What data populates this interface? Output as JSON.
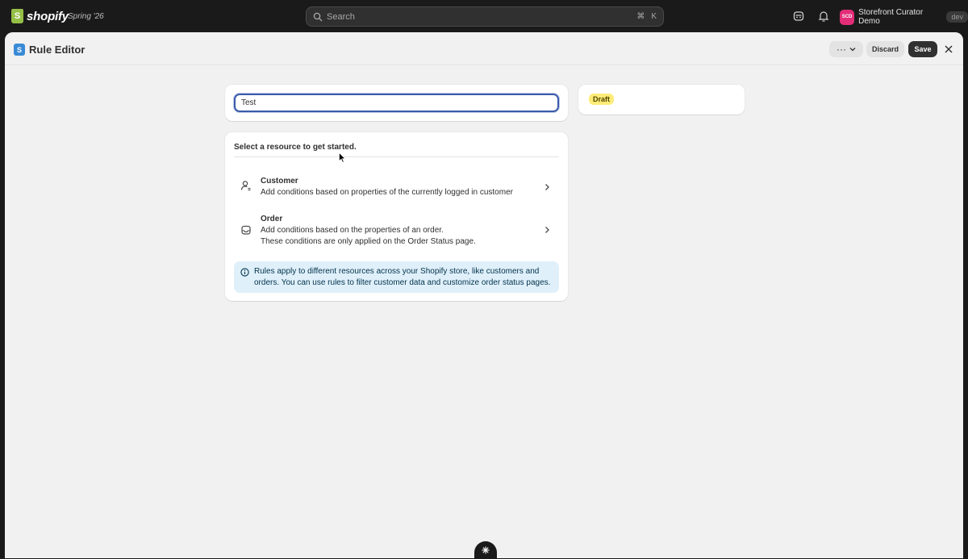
{
  "topbar": {
    "brand": "shopify",
    "release": "Spring '26",
    "search_placeholder": "Search",
    "shortcut_cmd": "⌘",
    "shortcut_key": "K",
    "store_initials": "SCD",
    "store_name": "Storefront Curator Demo",
    "store_badge": "dev"
  },
  "header": {
    "app_icon_letter": "S",
    "title": "Rule Editor",
    "more_label": "···",
    "discard_label": "Discard",
    "save_label": "Save"
  },
  "rule": {
    "name_value": "Test",
    "status": "Draft"
  },
  "resources": {
    "heading": "Select a resource to get started.",
    "items": [
      {
        "title": "Customer",
        "desc1": "Add conditions based on properties of the currently logged in customer",
        "desc2": ""
      },
      {
        "title": "Order",
        "desc1": "Add conditions based on the properties of an order.",
        "desc2": "These conditions are only applied on the Order Status page."
      }
    ],
    "info": "Rules apply to different resources across your Shopify store, like customers and orders. You can use rules to filter customer data and customize order status pages."
  },
  "colors": {
    "primary_button": "#303030",
    "focus_ring": "#3a5ba9",
    "draft_badge": "#ffeb78",
    "info_bg": "#e0f0fa",
    "store_avatar": "#e22d78"
  }
}
